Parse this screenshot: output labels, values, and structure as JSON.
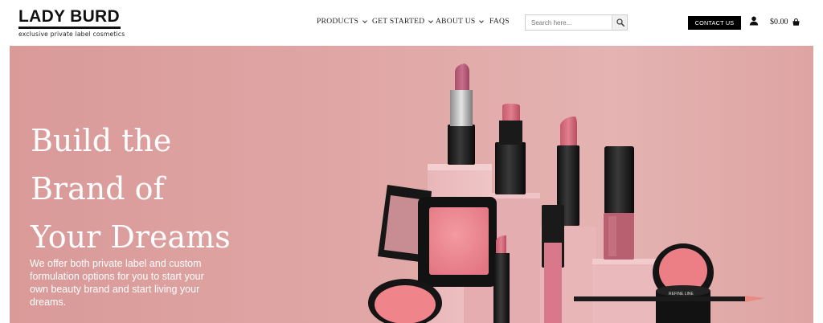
{
  "header": {
    "logo": {
      "name": "LADY BURD",
      "tagline": "exclusive private label cosmetics"
    },
    "nav": [
      {
        "label": "PRODUCTS",
        "dropdown": true
      },
      {
        "label": "GET STARTED",
        "dropdown": true
      },
      {
        "label": "ABOUT US",
        "dropdown": true
      },
      {
        "label": "FAQS",
        "dropdown": false
      }
    ],
    "search": {
      "placeholder": "Search here...",
      "value": ""
    },
    "contact_label": "CONTACT US",
    "cart_amount": "$0.00"
  },
  "hero": {
    "title_lines": [
      "Build the",
      "Brand of",
      "Your Dreams"
    ],
    "description": "We offer both private label and custom formulation options for you to start your own beauty brand and start living your dreams.",
    "product_label": "REFINE LINE"
  },
  "colors": {
    "hero_background": "#dea4a3",
    "button_black": "#000000",
    "text_white": "#ffffff"
  }
}
